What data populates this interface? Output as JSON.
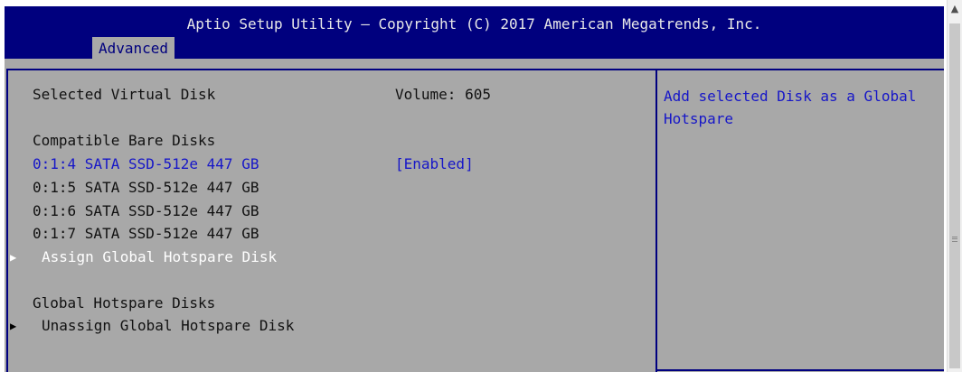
{
  "header": {
    "title": "Aptio Setup Utility – Copyright (C) 2017 American Megatrends, Inc.",
    "active_tab": "Advanced"
  },
  "main": {
    "selected_virtual_disk_label": "Selected Virtual Disk",
    "selected_virtual_disk_value": "Volume: 605",
    "compatible_bare_disks_label": "Compatible Bare Disks",
    "bare_disks": [
      {
        "label": "0:1:4 SATA SSD-512e 447 GB",
        "value": "[Enabled]"
      },
      {
        "label": "0:1:5 SATA SSD-512e 447 GB",
        "value": ""
      },
      {
        "label": "0:1:6 SATA SSD-512e 447 GB",
        "value": ""
      },
      {
        "label": "0:1:7 SATA SSD-512e 447 GB",
        "value": ""
      }
    ],
    "assign_action": "Assign Global Hotspare Disk",
    "global_hotspare_disks_label": "Global Hotspare Disks",
    "unassign_action": "Unassign Global Hotspare Disk"
  },
  "help": {
    "text": "Add selected Disk as a Global Hotspare"
  },
  "icons": {
    "submenu_arrow": "right-triangle-icon",
    "scroll_up": "up-triangle-icon"
  },
  "colors": {
    "header_bg": "#00007e",
    "panel_bg": "#a8a8a8",
    "selected_text": "#1616c8",
    "border": "#000080"
  }
}
